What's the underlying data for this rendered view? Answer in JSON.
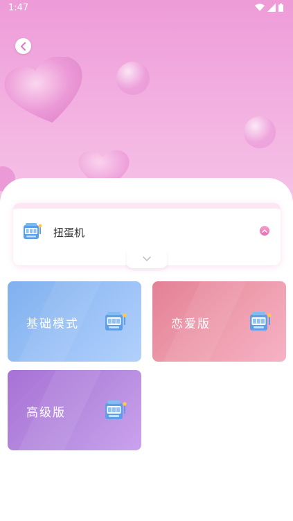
{
  "status_bar": {
    "time": "1:47"
  },
  "header": {
    "back_icon": "chevron-left-icon"
  },
  "selector": {
    "icon": "slot-machine-icon",
    "label": "扭蛋机",
    "toggle_icon": "chevron-up-icon",
    "expand_icon": "chevron-down-icon"
  },
  "modes": [
    {
      "label": "基础模式",
      "icon": "slot-machine-icon",
      "color": "#8bb8f2"
    },
    {
      "label": "恋爱版",
      "icon": "slot-machine-icon",
      "color": "#ea8fa2"
    },
    {
      "label": "高级版",
      "icon": "slot-machine-icon",
      "color": "#b47fdc"
    }
  ],
  "colors": {
    "accent_pink": "#ee9bd8",
    "sheet": "#ffffff"
  }
}
